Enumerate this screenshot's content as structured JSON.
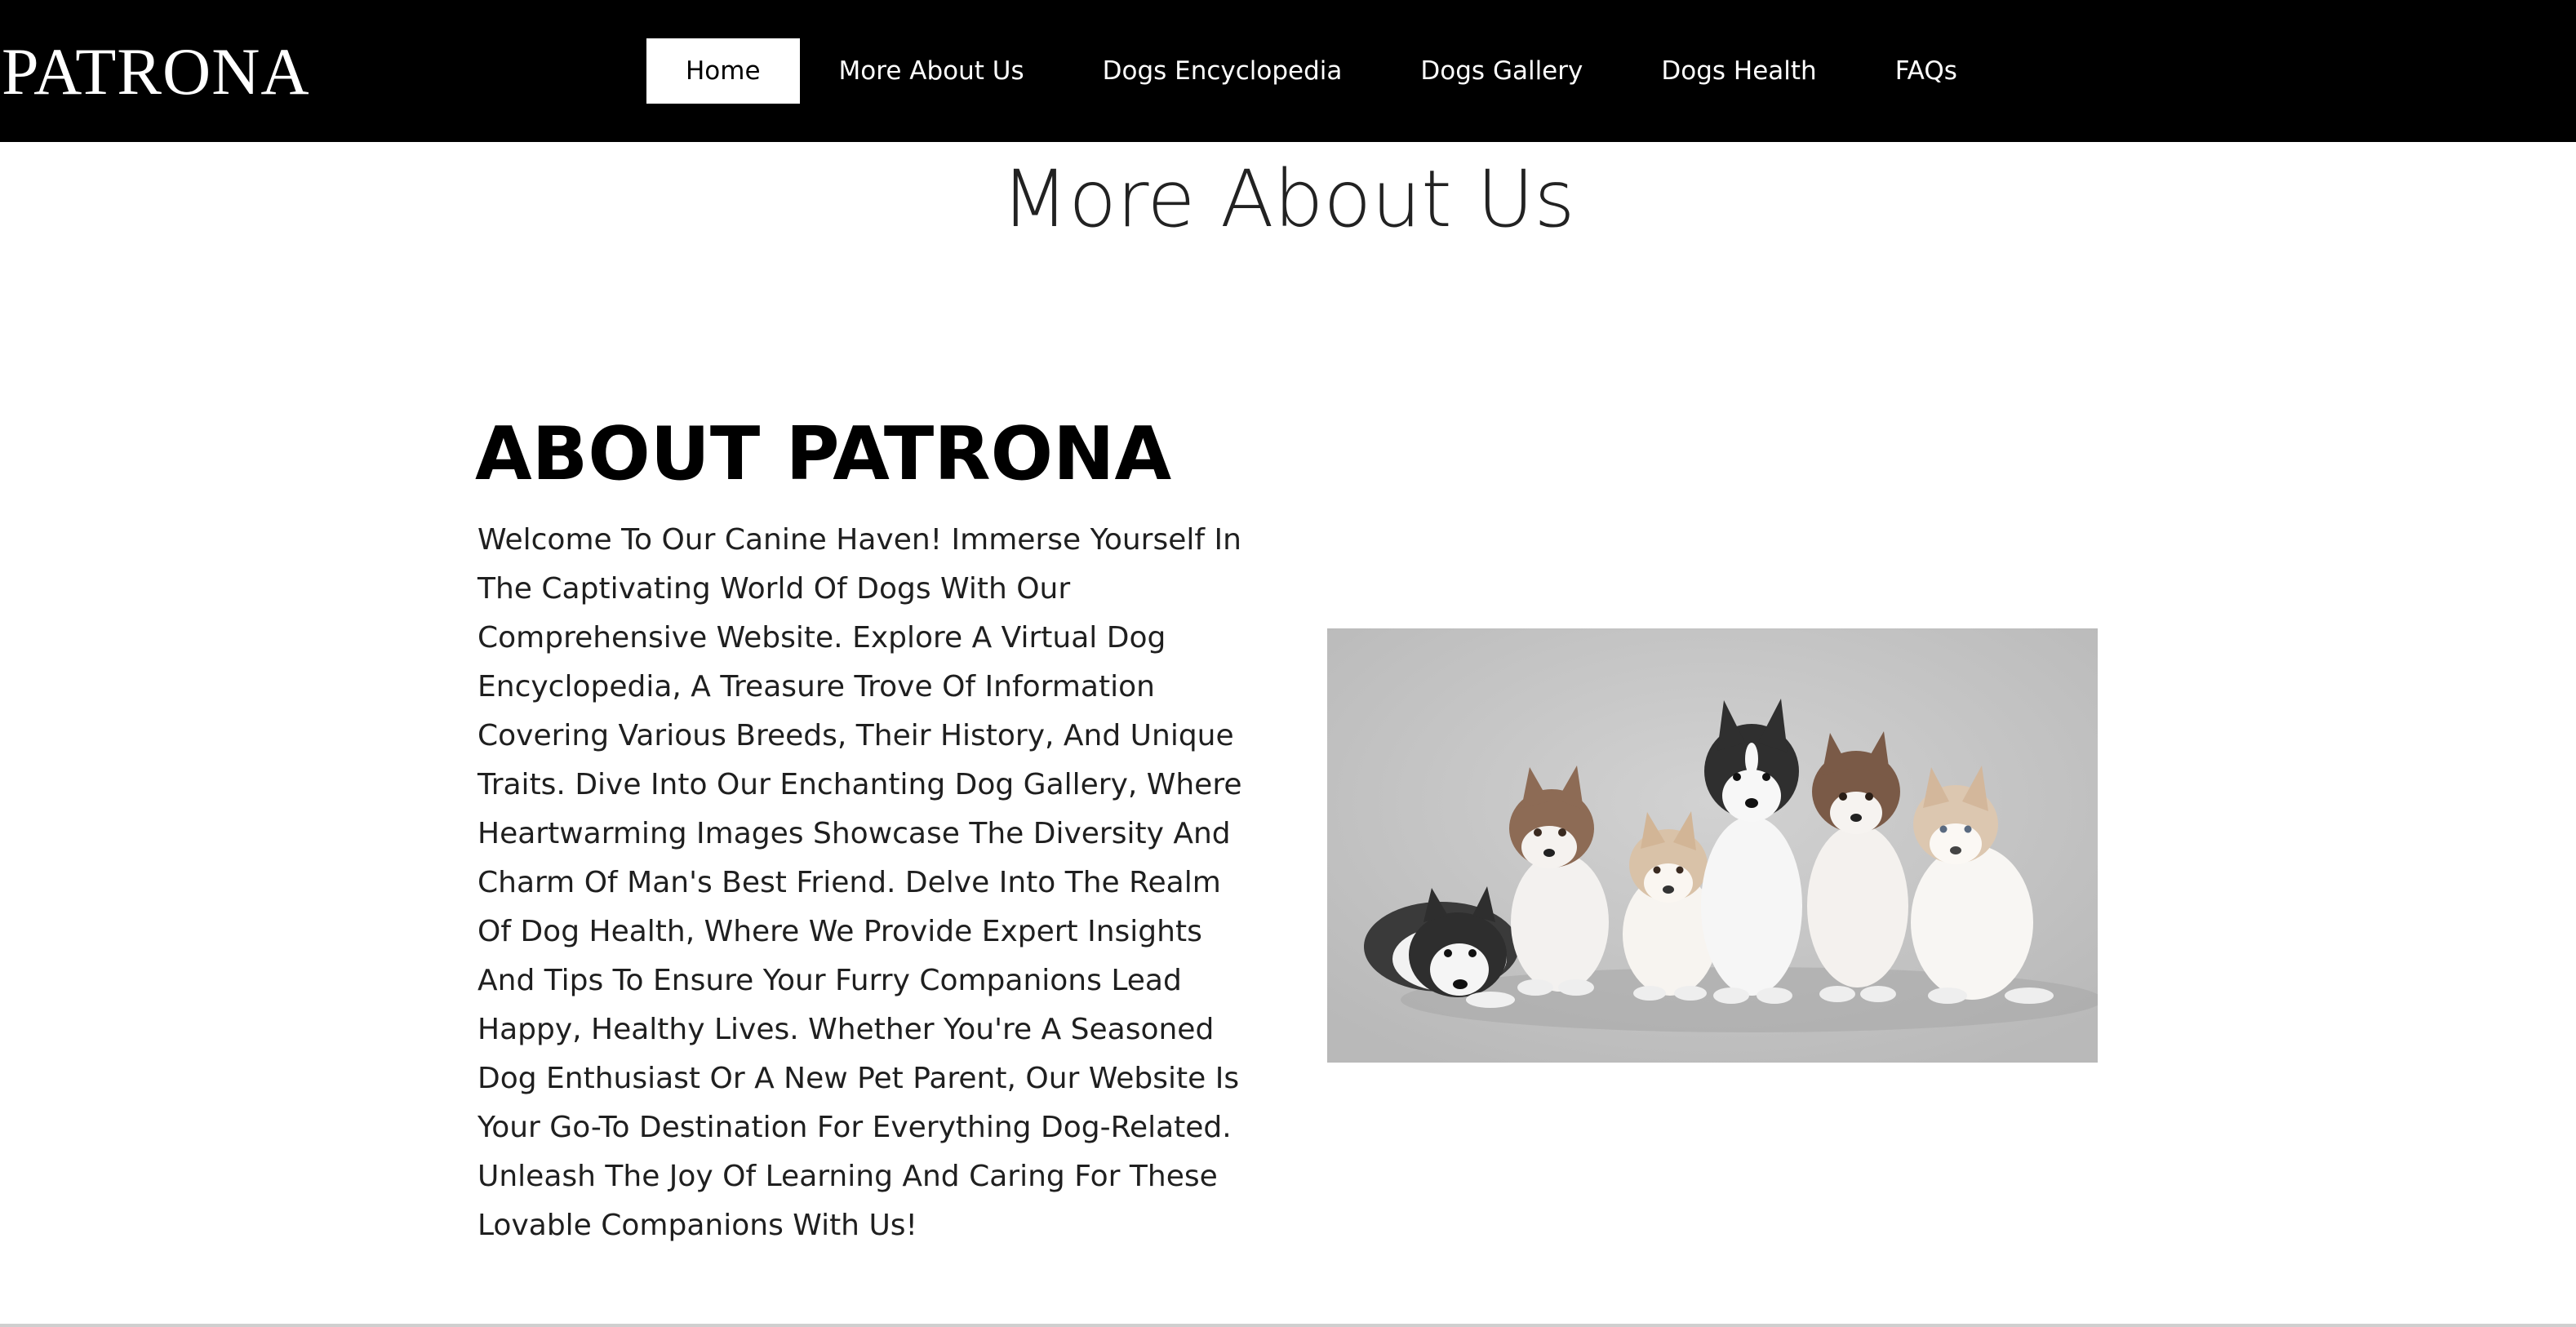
{
  "brand": {
    "logo_text": "PATRONA"
  },
  "nav": {
    "items": [
      {
        "label": "Home",
        "active": true
      },
      {
        "label": "More About Us",
        "active": false
      },
      {
        "label": "Dogs Encyclopedia",
        "active": false
      },
      {
        "label": "Dogs Gallery",
        "active": false
      },
      {
        "label": "Dogs Health",
        "active": false
      },
      {
        "label": "FAQs",
        "active": false
      }
    ]
  },
  "page": {
    "title": "More About Us"
  },
  "about": {
    "heading": "ABOUT PATRONA",
    "body": "Welcome To Our Canine Haven! Immerse Yourself In The Captivating World Of Dogs With Our Comprehensive Website. Explore A Virtual Dog Encyclopedia, A Treasure Trove Of Information Covering Various Breeds, Their History, And Unique Traits. Dive Into Our Enchanting Dog Gallery, Where Heartwarming Images Showcase The Diversity And Charm Of Man's Best Friend. Delve Into The Realm Of Dog Health, Where We Provide Expert Insights And Tips To Ensure Your Furry Companions Lead Happy, Healthy Lives. Whether You're A Seasoned Dog Enthusiast Or A New Pet Parent, Our Website Is Your Go-To Destination For Everything Dog-Related. Unleash The Joy Of Learning And Caring For These Lovable Companions With Us!"
  },
  "colors": {
    "nav_background": "#000000",
    "nav_text": "#ffffff",
    "nav_active_background": "#ffffff",
    "nav_active_text": "#000000",
    "page_background": "#ffffff",
    "photo_background": "#c9c9c9"
  }
}
